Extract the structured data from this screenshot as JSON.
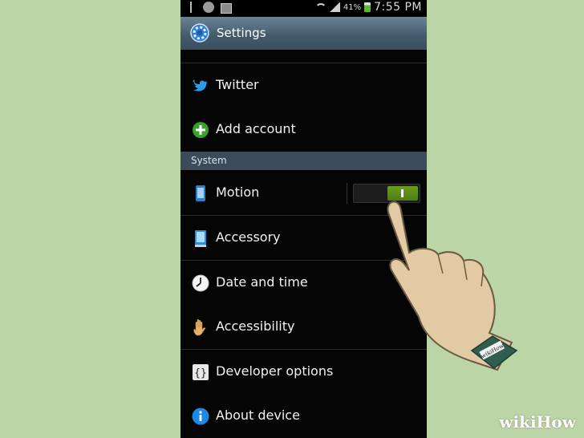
{
  "status_bar": {
    "battery_percent": "41%",
    "time": "7:55 PM",
    "icons": [
      "usb-icon",
      "globe-icon",
      "image-icon",
      "wifi-icon",
      "signal-icon",
      "battery-icon"
    ]
  },
  "header": {
    "title": "Settings",
    "icon": "gear-icon"
  },
  "accounts": [
    {
      "label": "Twitter",
      "icon": "twitter-bird-icon"
    },
    {
      "label": "Add account",
      "icon": "plus-circle-icon"
    }
  ],
  "system": {
    "header": "System",
    "items": [
      {
        "label": "Motion",
        "icon": "phone-motion-icon"
      },
      {
        "label": "Accessory",
        "icon": "accessory-phone-icon"
      },
      {
        "label": "Date and time",
        "icon": "clock-icon"
      },
      {
        "label": "Accessibility",
        "icon": "hand-icon"
      },
      {
        "label": "Developer options",
        "icon": "braces-icon"
      },
      {
        "label": "About device",
        "icon": "info-icon"
      }
    ]
  },
  "motion_toggle": {
    "state": "on",
    "on_label": "I",
    "color": "#5a8c16"
  },
  "watermark": {
    "text": "wikiHow"
  },
  "bracelet": {
    "text": "wikiHow"
  },
  "colors": {
    "background": "#bcd5a7",
    "header": "#43596a",
    "section": "#3c4b59"
  }
}
